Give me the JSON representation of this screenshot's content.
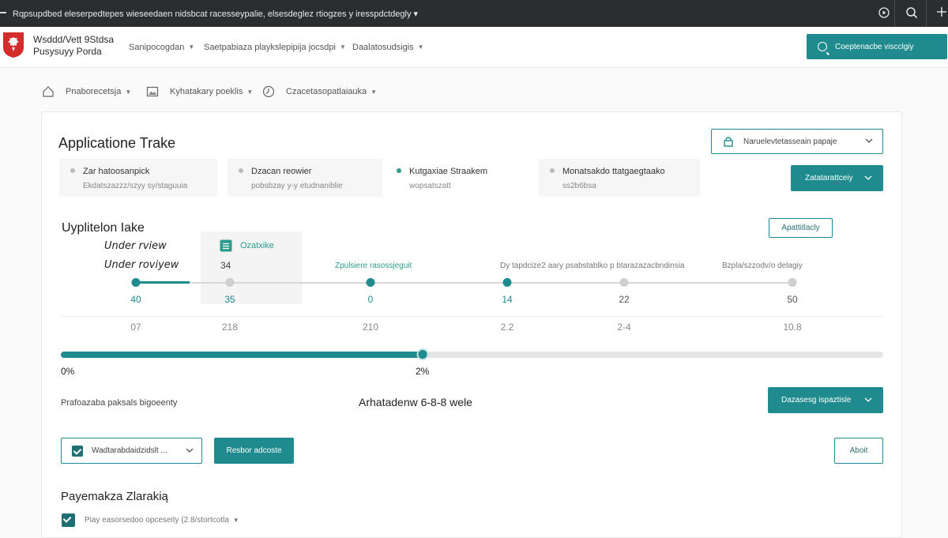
{
  "topbar": {
    "title": "Rqpsupdbed eleserpedtepes wieseedaen nidsbcat racesseypalie, elsesdeglez rtiogzes y iresspdctdegly ▾"
  },
  "header": {
    "logo_line1": "Wsddd/Vett 9Stdsa",
    "logo_line2": "Pusysuyy Porda",
    "nav": [
      {
        "label": "Sanipocogdan"
      },
      {
        "label": "Saetpabiaza playkslepipija jocsdpi"
      },
      {
        "label": "Daalatosudsigis"
      }
    ],
    "cta_label": "Coeptenacbe viscclgiy"
  },
  "breadcrumb": [
    {
      "label": "Pnaborecetsja",
      "icon": "home-icon"
    },
    {
      "label": "Kyhatakary poeklis",
      "icon": "image-icon"
    },
    {
      "label": "Czacetasopatlaiauka",
      "icon": "clock-icon"
    }
  ],
  "main": {
    "title": "Applicatione Trake",
    "top_select": "Naruelevtetasseain papaje",
    "top_button": "Zatatarattceiy",
    "tiles": [
      {
        "title": "Zar hatoosanpick",
        "sub": "Ekdatszazzz/szyy sy/staguuia",
        "active": false
      },
      {
        "title": "Dzacan reowier",
        "sub": "pobsbzay y-y etudnaniblie",
        "active": false
      },
      {
        "title": "Kutgaxiae Straakem",
        "sub": "wopsatszatt",
        "active": true
      },
      {
        "title": "Monatsakdo ttatgaegtaako",
        "sub": "ss2b6bsa",
        "active": false
      }
    ],
    "section_title": "Uyplitelon Iake",
    "section_button": "Apattitlacly",
    "under_review_1": "Under rview",
    "under_review_2": "Under roviyew",
    "panel_label": "Ozatxike",
    "panel_value": "34",
    "steps": [
      {
        "label": "",
        "top": "40",
        "bottom": "07",
        "active": true
      },
      {
        "label": "",
        "top": "35",
        "bottom": "218",
        "active": false
      },
      {
        "label": "Zpulsiere rasossjeguit",
        "top": "0",
        "bottom": "210",
        "active": true
      },
      {
        "label": "Dy tapdcize2 aary psabstablko p btarazazacbndinsia",
        "top": "14",
        "bottom": "2.2",
        "active": true
      },
      {
        "label": "",
        "top": "22",
        "bottom": "2-4",
        "active": false
      },
      {
        "label": "Bzpla/szzodv/o delagiy",
        "top": "50",
        "bottom": "10.8",
        "active": false
      }
    ],
    "progress": {
      "value_fraction": 0.44,
      "start_label": "0%",
      "current_label": "2%"
    },
    "note_left": "Prafoazaba paksals bigoeenty",
    "estimate": "Arhatadenw 6-8-8 wele",
    "note_button": "Dazasesg ispaztisle",
    "filter_select": "Wadtarabdaidzidslt ...",
    "filter_button": "Resbor adcoste",
    "abort_button": "Aboit",
    "payments_title": "Payemakza Zlarakią",
    "payments_check_label": "Piay easorsedoo opceseity (2.8/stortcotla"
  },
  "colors": {
    "accent": "#1f8b8f",
    "topbar": "#2b2d30"
  }
}
